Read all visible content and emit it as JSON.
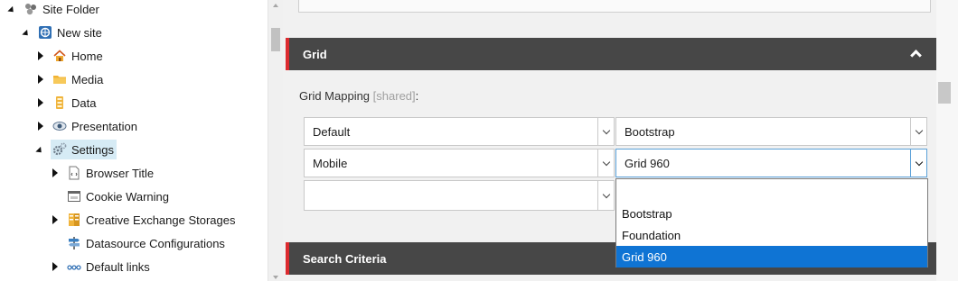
{
  "tree": {
    "items": [
      {
        "label": "Site Folder",
        "icon": "site-folder-icon",
        "expanded": true
      },
      {
        "label": "New site",
        "icon": "site-globe-icon",
        "expanded": true
      },
      {
        "label": "Home",
        "icon": "home-icon",
        "expanded": false
      },
      {
        "label": "Media",
        "icon": "media-folder-icon",
        "expanded": false
      },
      {
        "label": "Data",
        "icon": "data-icon",
        "expanded": false
      },
      {
        "label": "Presentation",
        "icon": "eye-icon",
        "expanded": false
      },
      {
        "label": "Settings",
        "icon": "gears-icon",
        "expanded": true,
        "selected": true
      },
      {
        "label": "Browser Title",
        "icon": "document-icon",
        "expanded": false
      },
      {
        "label": "Cookie Warning",
        "icon": "window-icon",
        "expanded": null
      },
      {
        "label": "Creative Exchange Storages",
        "icon": "storage-icon",
        "expanded": false
      },
      {
        "label": "Datasource Configurations",
        "icon": "signpost-icon",
        "expanded": null
      },
      {
        "label": "Default links",
        "icon": "links-icon",
        "expanded": false
      }
    ]
  },
  "grid_section": {
    "title": "Grid",
    "field_label": "Grid Mapping",
    "shared_tag": "[shared]",
    "colon": ":",
    "rows": [
      {
        "device": "Default",
        "grid": "Bootstrap"
      },
      {
        "device": "Mobile",
        "grid": "Grid 960"
      },
      {
        "device": "",
        "grid": ""
      }
    ],
    "dropdown_options": [
      "",
      "Bootstrap",
      "Foundation",
      "Grid 960"
    ],
    "dropdown_selected": "Grid 960"
  },
  "search_section": {
    "title": "Search Criteria"
  },
  "colors": {
    "accent_red": "#dc2b2f",
    "section_header_bg": "#474747",
    "selection_blue": "#0f74d4",
    "tree_selected_bg": "#d6ebf5"
  }
}
